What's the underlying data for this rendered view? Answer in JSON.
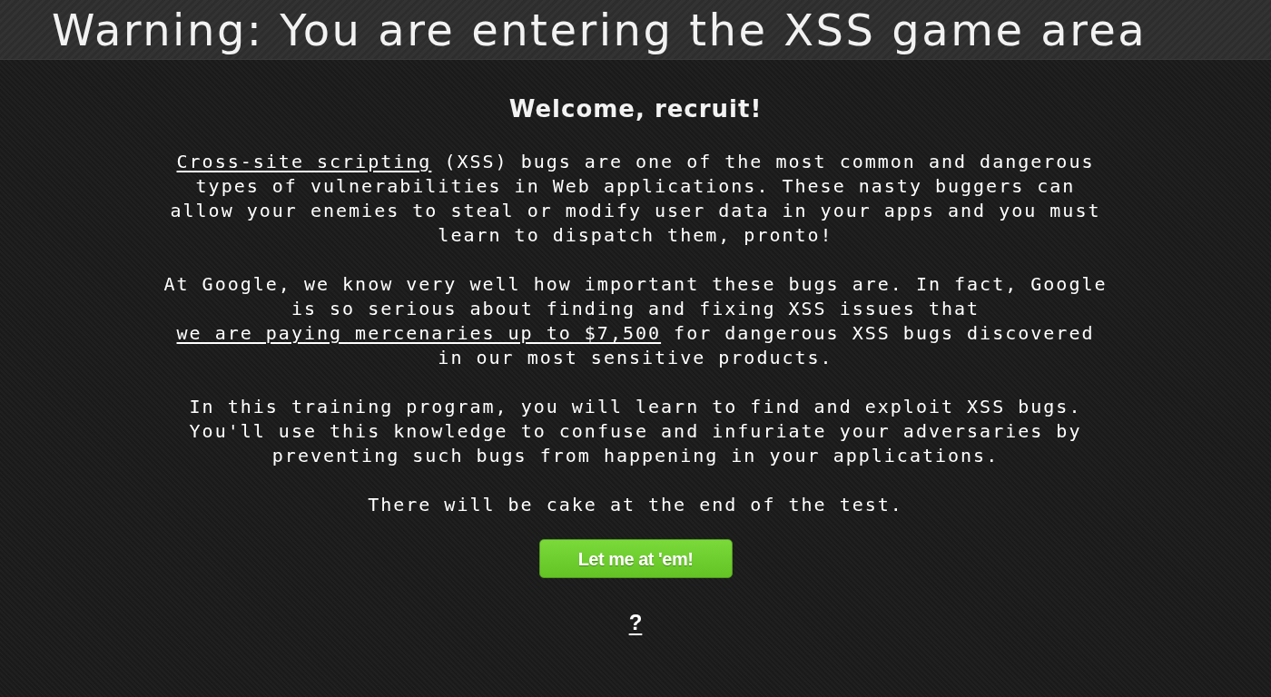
{
  "header": {
    "title": "Warning: You are entering the XSS game area"
  },
  "welcome": {
    "heading": "Welcome, recruit!",
    "paragraphs": [
      {
        "parts": [
          {
            "kind": "link",
            "text": "Cross-site scripting"
          },
          {
            "kind": "text",
            "text": " (XSS) bugs are one of the most common and dangerous types of vulnerabilities in Web applications. These nasty buggers can allow your enemies to steal or modify user data in your apps and you must learn to dispatch them, pronto!"
          }
        ]
      },
      {
        "parts": [
          {
            "kind": "text",
            "text": "At Google, we know very well how important these bugs are. In fact, Google is so serious about finding and fixing XSS issues that "
          },
          {
            "kind": "link",
            "text": "we are paying mercenaries up to $7,500"
          },
          {
            "kind": "text",
            "text": " for dangerous XSS bugs discovered in our most sensitive products."
          }
        ]
      },
      {
        "parts": [
          {
            "kind": "text",
            "text": "In this training program, you will learn to find and exploit XSS bugs. You'll use this knowledge to confuse and infuriate your adversaries by preventing such bugs from happening in your applications."
          }
        ]
      },
      {
        "parts": [
          {
            "kind": "text",
            "text": "There will be cake at the end of the test."
          }
        ]
      }
    ],
    "button": {
      "label": "Let me at 'em!"
    },
    "help_link": {
      "label": "?"
    }
  }
}
